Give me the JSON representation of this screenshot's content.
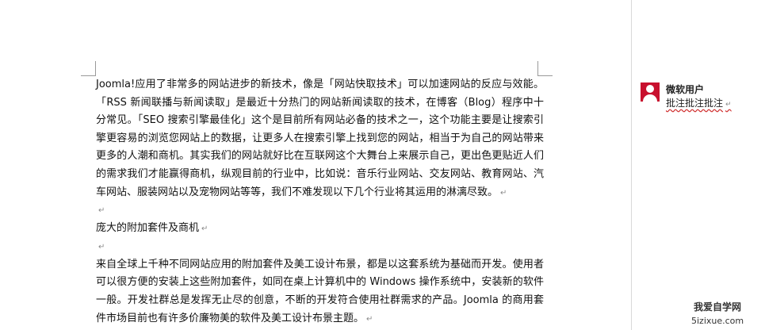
{
  "document": {
    "para1": "Joomla!应用了非常多的网站进步的新技术，像是「网站快取技术」可以加速网站的反应与效能。「RSS 新闻联播与新闻读取」是最近十分热门的网站新闻读取的技术，在博客（Blog）程序中十分常见。「SEO 搜索引擎最佳化」这个是目前所有网站必备的技术之一，这个功能主要是让搜索引擎更容易的浏览您网站上的数据，让更多人在搜索引擎上找到您的网站，相当于为自己的网站带来更多的人潮和商机。其实我们的网站就好比在互联网这个大舞台上来展示自己，更出色更贴近人们的需求我们才能赢得商机，纵观目前的行业中，比如说：音乐行业网站、交友网站、教育网站、汽车网站、服装网站以及宠物网站等等，我们不难发现以下几个行业将其运用的淋漓尽致。",
    "heading": "庞大的附加套件及商机",
    "para2": "来自全球上千种不同网站应用的附加套件及美工设计布景，都是以这套系统为基础而开发。使用者可以很方便的安装上这些附加套件，如同在桌上计算机中的 Windows 操作系统中，安装新的软件一般。开发社群总是发挥无止尽的创意，不断的开发符合使用社群需求的产品。Joomla 的商用套件市场目前也有许多价廉物美的软件及美工设计布景主题。",
    "paragraph_mark": "↵"
  },
  "comment": {
    "author": "微软用户",
    "text": "批注批注批注",
    "avatar_color": "#c8102e",
    "avatar_icon": "user-avatar-icon"
  },
  "watermark": {
    "line1": "我爱自学网",
    "line2": "5izixue.com"
  }
}
